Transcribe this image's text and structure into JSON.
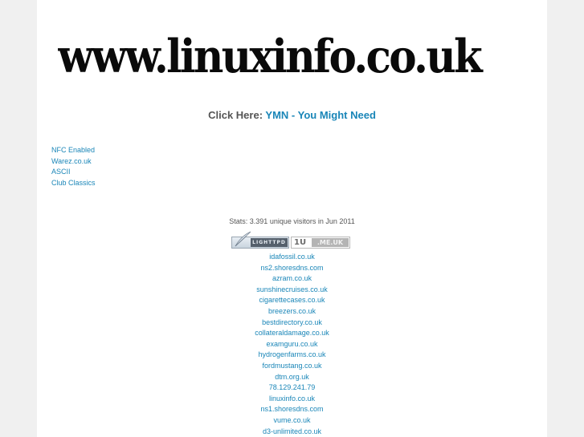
{
  "header": {
    "logo_text": "www.linuxinfo.co.uk"
  },
  "promo": {
    "prefix": "Click Here:",
    "link_label": "YMN - You Might Need"
  },
  "side_links": [
    {
      "label": "NFC Enabled"
    },
    {
      "label": "Warez.co.uk"
    },
    {
      "label": "ASCII"
    },
    {
      "label": "Club Classics"
    }
  ],
  "stats": {
    "text": "Stats: 3.391 unique visitors in Jun 2011"
  },
  "badges": {
    "lighttpd_label": "LIGHTTPD",
    "meuk_prefix": "1U",
    "meuk_domain": ".ME.UK"
  },
  "domains": [
    {
      "label": "idafossil.co.uk"
    },
    {
      "label": "ns2.shoresdns.com"
    },
    {
      "label": "azram.co.uk"
    },
    {
      "label": "sunshinecruises.co.uk"
    },
    {
      "label": "cigarettecases.co.uk"
    },
    {
      "label": "breezers.co.uk"
    },
    {
      "label": "bestdirectory.co.uk"
    },
    {
      "label": "collateraldamage.co.uk"
    },
    {
      "label": "examguru.co.uk"
    },
    {
      "label": "hydrogenfarms.co.uk"
    },
    {
      "label": "fordmustang.co.uk"
    },
    {
      "label": "dtm.org.uk"
    },
    {
      "label": "78.129.241.79"
    },
    {
      "label": "linuxinfo.co.uk"
    },
    {
      "label": "ns1.shoresdns.com"
    },
    {
      "label": "vume.co.uk"
    },
    {
      "label": "d3-unlimited.co.uk"
    }
  ],
  "colors": {
    "link": "#1a86b8",
    "text_gray": "#555555",
    "page_bg": "#f0f0f0",
    "panel_bg": "#ffffff"
  }
}
